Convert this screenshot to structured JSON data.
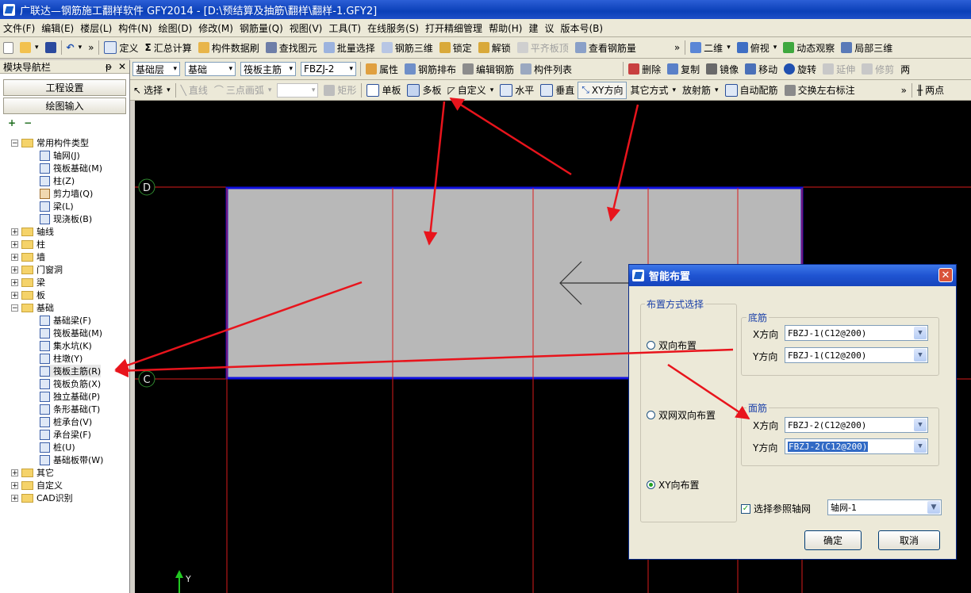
{
  "window": {
    "title": "广联达—钢筋施工翻样软件 GFY2014 - [D:\\预结算及抽筋\\翻样\\翻样-1.GFY2]"
  },
  "menu": [
    "文件(F)",
    "编辑(E)",
    "楼层(L)",
    "构件(N)",
    "绘图(D)",
    "修改(M)",
    "钢筋量(Q)",
    "视图(V)",
    "工具(T)",
    "在线服务(S)",
    "打开精细管理",
    "帮助(H)",
    "建",
    "议",
    "版本号(B)"
  ],
  "toolbar1": {
    "more": "»",
    "more2": "»",
    "items": [
      "定义",
      "汇总计算",
      "构件数据刷",
      "查找图元",
      "批量选择",
      "钢筋三维",
      "锁定",
      "解锁",
      "平齐板顶",
      "查看钢筋量"
    ],
    "view_items": [
      "二维",
      "俯视",
      "动态观察",
      "局部三维"
    ]
  },
  "toolbar2": {
    "floor": "基础层",
    "type": "基础",
    "component": "筏板主筋",
    "name": "FBZJ-2",
    "items": [
      "属性",
      "钢筋排布",
      "编辑钢筋",
      "构件列表"
    ],
    "edit_items": [
      "删除",
      "复制",
      "镜像",
      "移动",
      "旋转",
      "延伸",
      "修剪"
    ],
    "tail": "两"
  },
  "toolbar3": {
    "select": "选择",
    "line": "直线",
    "arc": "三点画弧",
    "rect": "矩形",
    "items": [
      "单板",
      "多板",
      "自定义",
      "水平",
      "垂直",
      "XY方向",
      "其它方式",
      "放射筋",
      "自动配筋",
      "交换左右标注"
    ],
    "more": "»",
    "tail": "两点"
  },
  "nav": {
    "title": "模块导航栏",
    "pin": "ᵽ",
    "close": "✕",
    "btn_project": "工程设置",
    "btn_draw": "绘图输入",
    "add": "+",
    "remove": "−",
    "common": "常用构件类型",
    "common_items": [
      "轴网(J)",
      "筏板基础(M)",
      "柱(Z)",
      "剪力墙(Q)",
      "梁(L)",
      "现浇板(B)"
    ],
    "groups": [
      "轴线",
      "柱",
      "墙",
      "门窗洞",
      "梁",
      "板"
    ],
    "foundation": "基础",
    "foundation_items": [
      "基础梁(F)",
      "筏板基础(M)",
      "集水坑(K)",
      "柱墩(Y)",
      "筏板主筋(R)",
      "筏板负筋(X)",
      "独立基础(P)",
      "条形基础(T)",
      "桩承台(V)",
      "承台梁(F)",
      "桩(U)",
      "基础板带(W)"
    ],
    "tail_groups": [
      "其它",
      "自定义",
      "CAD识别"
    ]
  },
  "canvas": {
    "axis_d": "D",
    "axis_c": "C",
    "y_label": "Y"
  },
  "dialog": {
    "title": "智能布置",
    "close": "✕",
    "mode_group": "布置方式选择",
    "modes": [
      "双向布置",
      "双网双向布置",
      "XY向布置"
    ],
    "selected_mode": "XY向布置",
    "bottom_group": "底筋",
    "top_group": "面筋",
    "x_label": "X方向",
    "y_label": "Y方向",
    "bottom_x": "FBZJ-1(C12@200)",
    "bottom_y": "FBZJ-1(C12@200)",
    "top_x": "FBZJ-2(C12@200)",
    "top_y": "FBZJ-2(C12@200)",
    "ref_axis_label": "选择参照轴网",
    "ref_axis_checked": true,
    "ref_axis_value": "轴网-1",
    "ok": "确定",
    "cancel": "取消"
  }
}
